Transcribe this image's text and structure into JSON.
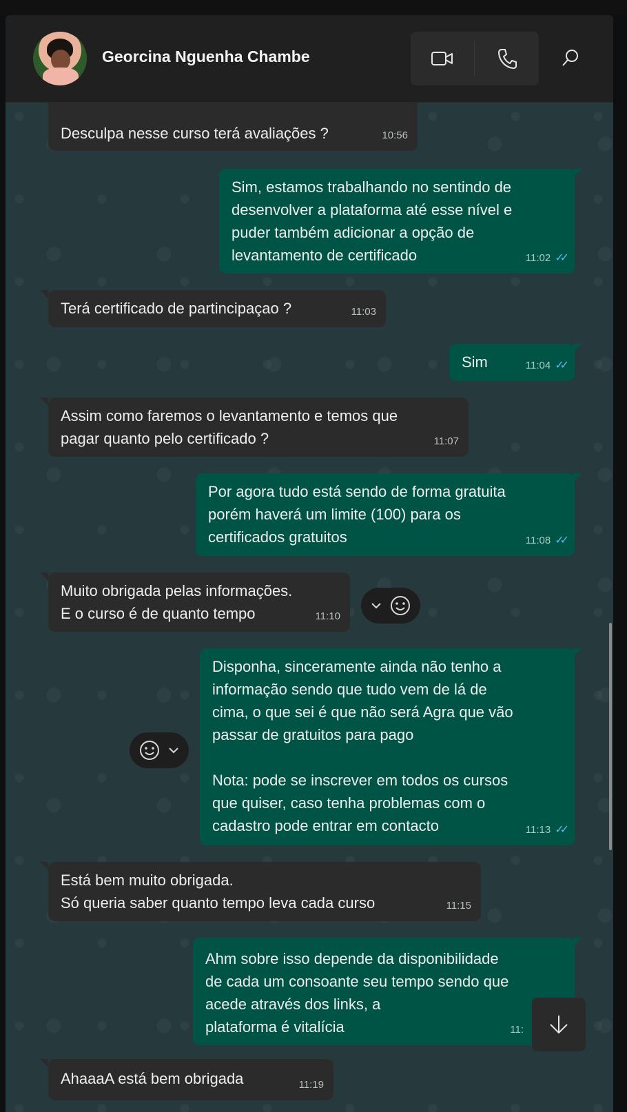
{
  "header": {
    "contact_name": "Georcina Nguenha Chambe"
  },
  "icons": {
    "video": "video-call-icon",
    "voice": "voice-call-icon",
    "search": "search-icon",
    "emoji": "emoji-icon",
    "chevron": "chevron-down-icon",
    "scroll": "arrow-down-icon"
  },
  "colors": {
    "incoming_bubble": "#2b2b2b",
    "outgoing_bubble": "#005446",
    "read_ticks": "#53bdeb"
  },
  "messages": [
    {
      "dir": "in",
      "text": "Desculpa nesse curso terá avaliações ?",
      "time": "10:56"
    },
    {
      "dir": "out",
      "text": "Sim, estamos trabalhando no sentindo de\ndesenvolver a plataforma até esse nível e\npuder também adicionar a opção de\nlevantamento de certificado",
      "time": "11:02"
    },
    {
      "dir": "in",
      "text": "Terá certificado de partincipaçao ?",
      "time": "11:03"
    },
    {
      "dir": "out",
      "text": "Sim",
      "time": "11:04"
    },
    {
      "dir": "in",
      "text": "Assim como faremos o levantamento e temos que\npagar quanto pelo certificado ?",
      "time": "11:07"
    },
    {
      "dir": "out",
      "text": "Por agora tudo está sendo de forma gratuita\nporém haverá um limite (100) para os\ncertificados gratuitos",
      "time": "11:08"
    },
    {
      "dir": "in",
      "text": "Muito obrigada pelas informações.\nE o curso é de quanto tempo",
      "time": "11:10"
    },
    {
      "dir": "out",
      "text": "Disponha, sinceramente ainda não tenho a\ninformação sendo que tudo vem de lá de\ncima, o que sei é que não será Agra que vão\npassar de gratuitos para pago\n\nNota: pode se inscrever em todos os cursos\nque quiser, caso tenha problemas com o\ncadastro pode entrar em contacto",
      "time": "11:13"
    },
    {
      "dir": "in",
      "text": "Está bem muito obrigada.\nSó queria saber quanto tempo leva cada curso",
      "time": "11:15"
    },
    {
      "dir": "out",
      "text": "Ahm sobre isso depende da disponibilidade\nde cada um consoante seu tempo sendo que\nacede através dos links, a\nplataforma é vitalícia",
      "time": "11:"
    },
    {
      "dir": "in",
      "text": "AhaaaA está bem obrigada",
      "time": "11:19"
    }
  ]
}
